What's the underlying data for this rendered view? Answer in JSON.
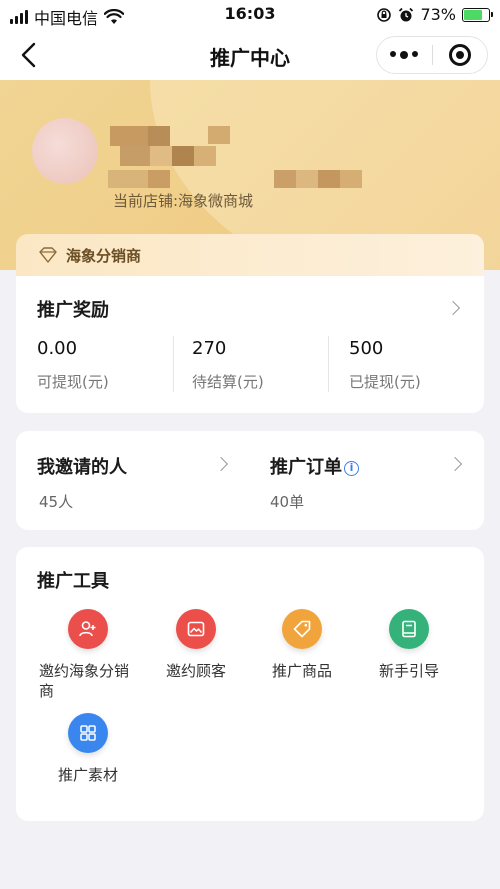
{
  "status_bar": {
    "carrier": "中国电信",
    "time": "16:03",
    "battery_percent": "73%",
    "battery_level": 0.73
  },
  "nav": {
    "title": "推广中心"
  },
  "profile": {
    "store_line": "当前店铺:海象微商城"
  },
  "membership": {
    "label": "海象分销商"
  },
  "rewards": {
    "title": "推广奖励",
    "stats": [
      {
        "value": "0.00",
        "label": "可提现(元)"
      },
      {
        "value": "270",
        "label": "待结算(元)"
      },
      {
        "value": "500",
        "label": "已提现(元)"
      }
    ]
  },
  "invite": {
    "people_title": "我邀请的人",
    "people_count": "45人",
    "orders_title": "推广订单",
    "orders_count": "40单"
  },
  "tools": {
    "title": "推广工具",
    "items": [
      {
        "label": "邀约海象分销商",
        "icon": "add-user-icon",
        "color": "#ea4f4c"
      },
      {
        "label": "邀约顾客",
        "icon": "image-icon",
        "color": "#ec4f4a"
      },
      {
        "label": "推广商品",
        "icon": "tag-icon",
        "color": "#f2a43c"
      },
      {
        "label": "新手引导",
        "icon": "book-icon",
        "color": "#35b27a"
      },
      {
        "label": "推广素材",
        "icon": "grid-icon",
        "color": "#3a86ef"
      }
    ]
  },
  "colors": {
    "header_gold": "#f0cf8a",
    "accent_blue": "#3a7fe6"
  }
}
